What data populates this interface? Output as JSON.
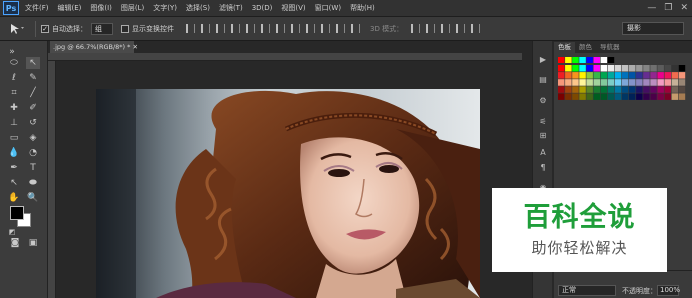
{
  "app": {
    "logo": "Ps"
  },
  "menu": [
    "文件(F)",
    "编辑(E)",
    "图像(I)",
    "图层(L)",
    "文字(Y)",
    "选择(S)",
    "滤镜(T)",
    "3D(D)",
    "视图(V)",
    "窗口(W)",
    "帮助(H)"
  ],
  "window_controls": {
    "minimize": "—",
    "restore": "❐",
    "close": "✕"
  },
  "options": {
    "auto_select_label": "自动选择：",
    "auto_select_value": "组",
    "show_transform_label": "显示变换控件",
    "mode_3d": "3D 模式：",
    "workspace": "摄影"
  },
  "document": {
    "tab_label": ".jpg @ 66.7%(RGB/8*) * ✕"
  },
  "panel": {
    "tabs": [
      "色板",
      "颜色",
      "导航器"
    ]
  },
  "layers": {
    "blend_mode": "正常",
    "opacity_label": "不透明度：",
    "opacity_value": "100%"
  },
  "watermark": {
    "title": "百科全说",
    "subtitle": "助你轻松解决"
  },
  "colors": {
    "fg": "#000000",
    "bg": "#ffffff",
    "brand_green": "#1f9e3a"
  }
}
